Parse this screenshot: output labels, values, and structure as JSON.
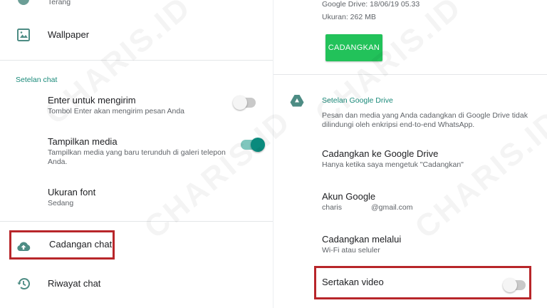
{
  "watermark": "CHARIS.ID",
  "left": {
    "theme_value": "Terang",
    "wallpaper_label": "Wallpaper",
    "chat_settings_section": "Setelan chat",
    "enter_send": {
      "title": "Enter untuk mengirim",
      "subtitle": "Tombol Enter akan mengirim pesan Anda",
      "enabled": false
    },
    "media_visibility": {
      "title": "Tampilkan media",
      "subtitle": "Tampilkan media yang baru terunduh di galeri telepon Anda.",
      "enabled": true
    },
    "font_size": {
      "title": "Ukuran font",
      "value": "Sedang"
    },
    "chat_backup_label": "Cadangan chat",
    "chat_history_label": "Riwayat chat"
  },
  "right": {
    "google_drive_info": "Google Drive: 18/06/19 05.33",
    "size_info": "Ukuran: 262 MB",
    "backup_button": "CADANGKAN",
    "gdrive_section": "Setelan Google Drive",
    "gdrive_note": "Pesan dan media yang Anda cadangkan di Google Drive tidak dilindungi oleh enkripsi end-to-end WhatsApp.",
    "backup_to_drive": {
      "title": "Cadangkan ke Google Drive",
      "value": "Hanya ketika saya mengetuk \"Cadangkan\""
    },
    "google_account": {
      "title": "Akun Google",
      "name": "charis",
      "domain": "@gmail.com"
    },
    "backup_over": {
      "title": "Cadangkan melalui",
      "value": "Wi-Fi atau seluler"
    },
    "include_videos": {
      "title": "Sertakan video",
      "enabled": false
    }
  },
  "colors": {
    "accent": "#1b8a7a",
    "button": "#22c25a",
    "highlight": "#b8262a"
  },
  "icons": [
    "theme-icon",
    "wallpaper-icon",
    "cloud-upload-icon",
    "history-icon",
    "google-drive-icon"
  ]
}
